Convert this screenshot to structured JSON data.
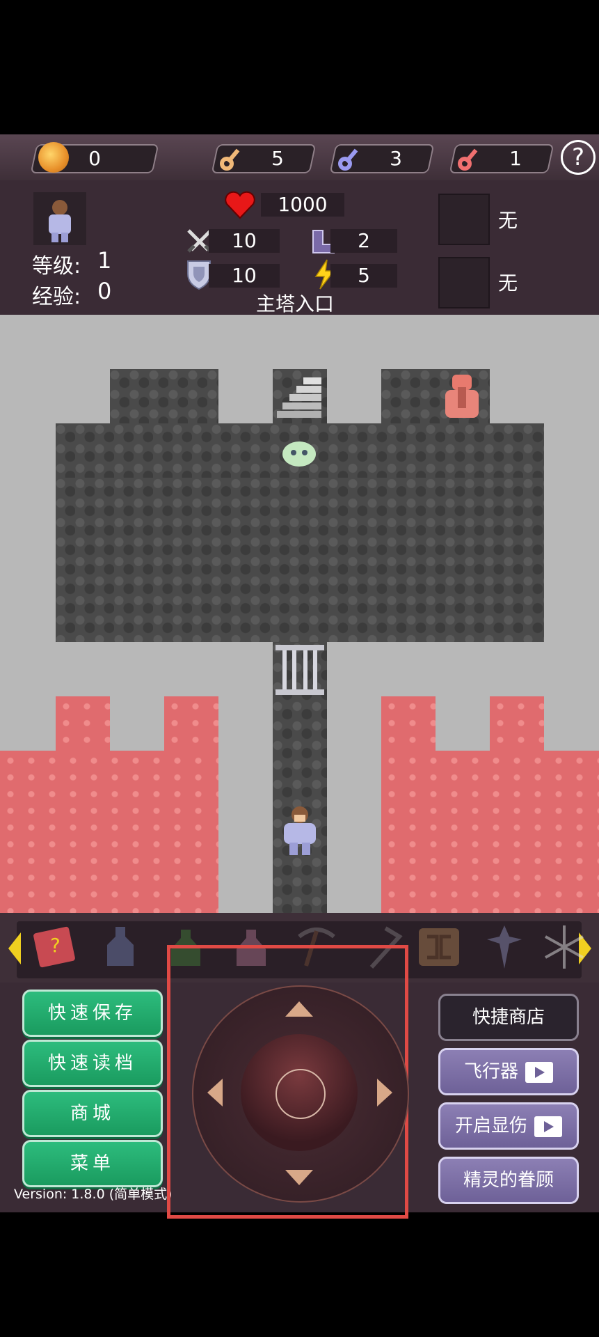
{
  "resources": {
    "gold": "0",
    "yellow_keys": "5",
    "blue_keys": "3",
    "red_keys": "1",
    "help_label": "?"
  },
  "hero": {
    "level_label": "等级:",
    "level_value": "1",
    "exp_label": "经验:",
    "exp_value": "0",
    "hp": "1000",
    "attack": "10",
    "defense": "10",
    "speed": "2",
    "energy": "5"
  },
  "equipment": {
    "slot1_label": "无",
    "slot2_label": "无"
  },
  "floor_name": "主塔入口",
  "buttons": {
    "quick_save": "快速保存",
    "quick_load": "快速读档",
    "shop": "商城",
    "menu": "菜单",
    "quick_shop": "快捷商店",
    "fly": "飞行器",
    "show_damage": "开启显伤",
    "fairy": "精灵的眷顾"
  },
  "version": "Version: 1.8.0 (简单模式)",
  "colors": {
    "green_button": "#1fae6b",
    "purple_button": "#7e71a8",
    "lava": "#e06b6e",
    "frame_highlight": "#e04a45"
  },
  "inventory_icons": [
    "monster-book-icon",
    "bottle-icon",
    "green-potion-icon",
    "pink-potion-icon",
    "pickaxe-icon",
    "pickaxe2-icon",
    "bomb-icon",
    "cross-icon",
    "snowflake-icon"
  ]
}
